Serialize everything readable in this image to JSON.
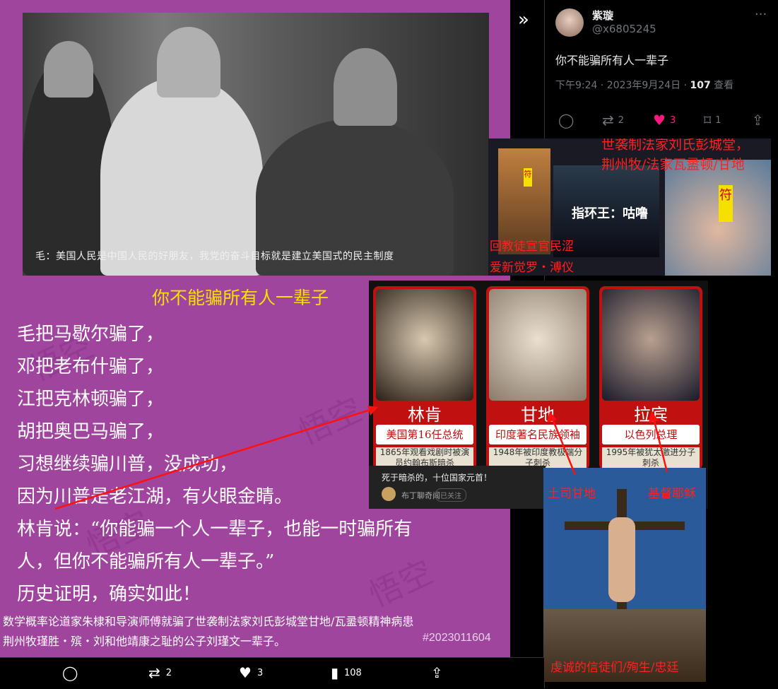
{
  "card": {
    "photo_caption": "毛：美国人民是中国人民的好朋友，我党的奋斗目标就是建立美国式的民主制度",
    "title": "你不能骗所有人一辈子",
    "lines": [
      "毛把马歇尔骗了，",
      "邓把老布什骗了，",
      "江把克林顿骗了，",
      "胡把奥巴马骗了，",
      "习想继续骗川普，没成功，",
      "因为川普是老江湖，有火眼金睛。",
      "林肯说：“你能骗一个人一辈子，也能一时骗所有",
      "人，但你不能骗所有人一辈子。”",
      "历史证明，确实如此！"
    ],
    "bottom_line1": "数学概率论道家朱棣和导演师傅就骗了世袭制法家刘氏彭城堂甘地/瓦盝顿精神病患",
    "bottom_line2": "荆州牧瑾胜・殡・刘和他靖康之耻的公子刘瑾文一辈子。",
    "hashtag": "#2023011604"
  },
  "tweet": {
    "name": "紫璇",
    "handle": "@x6805245",
    "text": "你不能骗所有人一辈子",
    "time": "下午9:24 · 2023年9月24日 · ",
    "views": "107",
    "views_label": " 查看",
    "replies": "",
    "retweets": "2",
    "likes": "3",
    "bookmarks": "1"
  },
  "collage_top": {
    "label_right1": "世袭制法家刘氏彭城堂，",
    "label_right2": "荆州牧/法家瓦盝顿/甘地",
    "label_left1": "回教徒宣官民涩",
    "label_left2": "爱新觉罗・溥仪",
    "tag": "符",
    "movie_title": "指环王：咕噜"
  },
  "collage_mid": {
    "cards": [
      {
        "name": "林肯",
        "sub": "美国第16任总统",
        "desc": "1865年观看戏剧时被演员约翰布斯暗杀"
      },
      {
        "name": "甘地",
        "sub": "印度著名民族领袖",
        "desc": "1948年被印度教极端分子刺杀"
      },
      {
        "name": "拉宾",
        "sub": "以色列总理",
        "desc": "1995年被犹太激进分子刺杀"
      }
    ],
    "video_title": "死于暗杀的，十位国家元首！",
    "channel": "布丁聊奇闻",
    "follow": "已关注"
  },
  "collage_bottom": {
    "label_left": "土司甘地",
    "label_right": "基督耶稣",
    "label_bottom": "虔诚的信徒们/殉生/忠廷"
  },
  "bottom_bar": {
    "retweets": "2",
    "likes": "3",
    "views": "108"
  },
  "colors": {
    "accent_like": "#f91880",
    "card_bg": "#a0459e",
    "title_yellow": "#f6e000",
    "annotation_red": "#ff2020"
  }
}
